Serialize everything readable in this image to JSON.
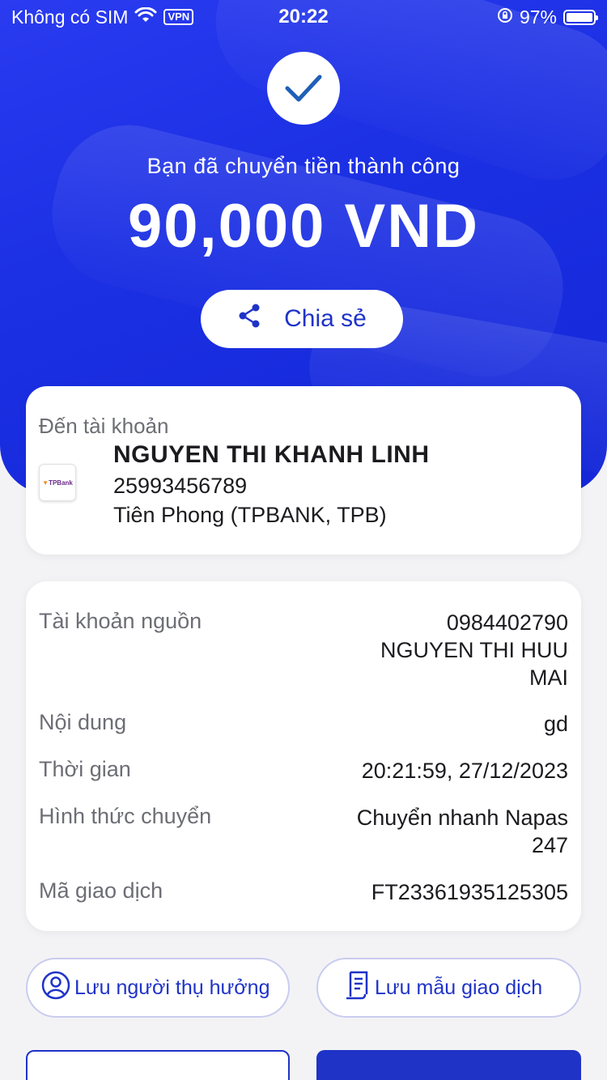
{
  "status_bar": {
    "carrier": "Không có SIM",
    "vpn": "VPN",
    "time": "20:22",
    "battery": "97%",
    "battery_level": 0.97
  },
  "header": {
    "success_message": "Bạn đã chuyển tiền thành công",
    "amount": "90,000 VND",
    "share_label": "Chia sẻ"
  },
  "recipient": {
    "label": "Đến tài khoản",
    "name": "NGUYEN THI KHANH LINH",
    "account": "25993456789",
    "bank": "Tiên Phong (TPBANK, TPB)",
    "logo_text": "TPBank"
  },
  "details": {
    "source_label": "Tài khoản nguồn",
    "source_account": "0984402790",
    "source_name_line1": "NGUYEN THI HUU",
    "source_name_line2": "MAI",
    "content_label": "Nội dung",
    "content_value": "gd",
    "time_label": "Thời gian",
    "time_value": "20:21:59, 27/12/2023",
    "method_label": "Hình thức chuyển",
    "method_value_line1": "Chuyển nhanh Napas",
    "method_value_line2": "247",
    "txn_label": "Mã giao dịch",
    "txn_value": "FT23361935125305"
  },
  "actions": {
    "save_beneficiary": "Lưu người thụ hưởng",
    "save_template": "Lưu mẫu giao dịch"
  },
  "colors": {
    "primary": "#1f33c7",
    "hero": "#1c30e4",
    "background": "#f3f3f6"
  }
}
